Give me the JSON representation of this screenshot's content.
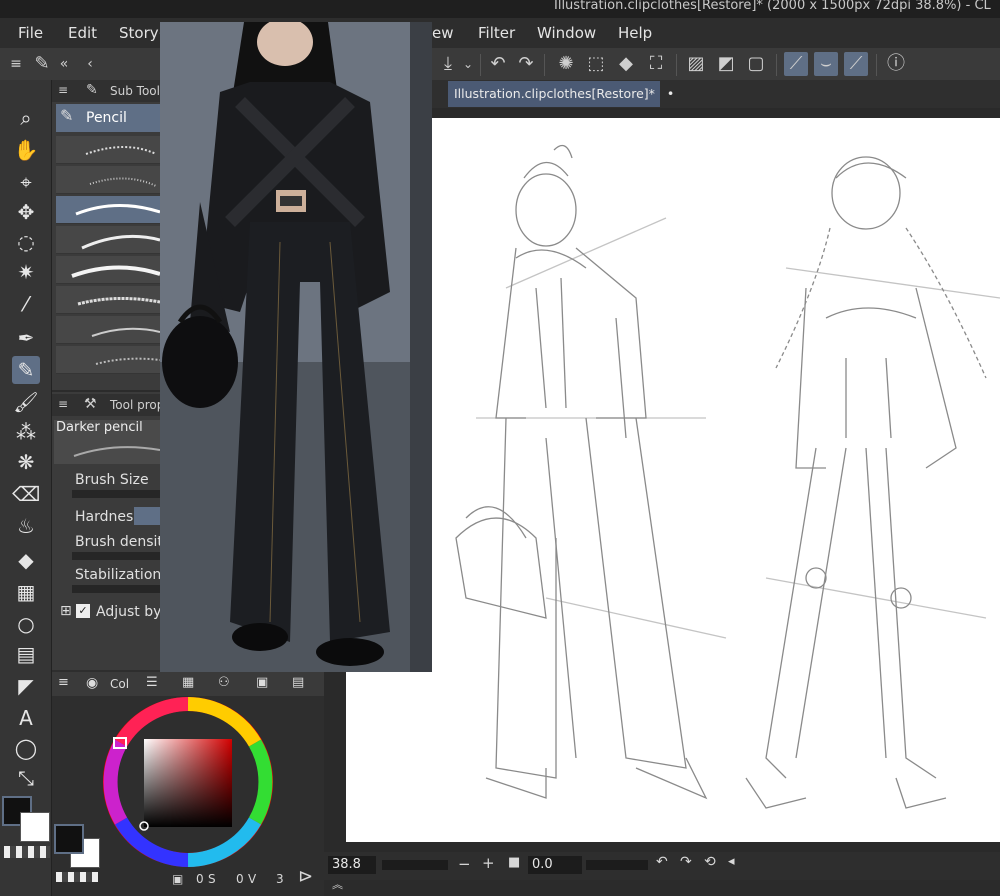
{
  "window": {
    "title": "Illustration.clipclothes[Restore]* (2000 x 1500px 72dpi 38.8%) - CL"
  },
  "menu": {
    "file": "File",
    "edit": "Edit",
    "story": "Story(",
    "view": "ew",
    "filter": "Filter",
    "window": "Window",
    "help": "Help"
  },
  "document_tab": {
    "label": "Illustration.clipclothes[Restore]*",
    "dot": "•"
  },
  "subtool_panel": {
    "header": "Sub Tool",
    "selected": "Pencil"
  },
  "tool_property": {
    "header": "Tool prop",
    "preset": "Darker pencil",
    "brush_size": "Brush Size",
    "hardness": "Hardness",
    "brush_density": "Brush density",
    "stabilization": "Stabilization",
    "adjust_by": "Adjust by s"
  },
  "color_panel": {
    "tab_label": "Col",
    "count_a": "0",
    "count_b": "0",
    "count_c": "3",
    "marker_a": "S",
    "marker_b": "V"
  },
  "status": {
    "zoom": "38.8",
    "rotation": "0.0"
  },
  "colors": {
    "accent": "#5f6f86",
    "panel": "#3b3b3b",
    "canvas": "#ffffff",
    "bg": "#2b2b2b"
  }
}
